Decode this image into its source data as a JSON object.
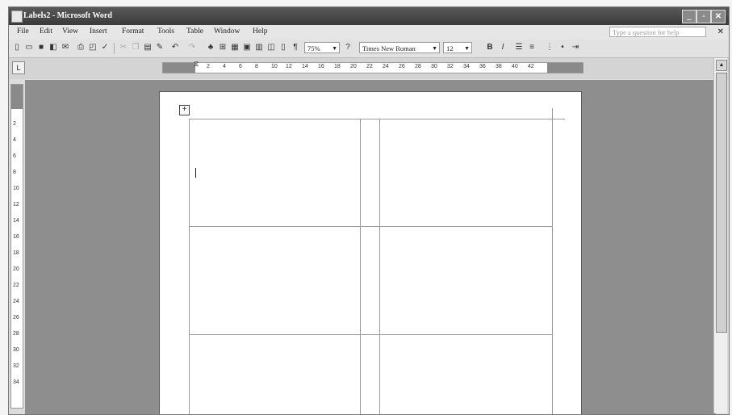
{
  "window": {
    "title": "Labels2 - Microsoft Word"
  },
  "menubar": {
    "items": [
      "File",
      "Edit",
      "View",
      "Insert",
      "Format",
      "Tools",
      "Table",
      "Window",
      "Help"
    ],
    "help_placeholder": "Type a question for help"
  },
  "toolbar": {
    "zoom": "75%",
    "font": "Times New Roman",
    "size": "12"
  },
  "ruler": {
    "ticks": [
      "2",
      "4",
      "6",
      "8",
      "10",
      "12",
      "14",
      "16",
      "18",
      "20",
      "22",
      "24",
      "26",
      "28",
      "30",
      "32",
      "34",
      "36",
      "38",
      "40",
      "42"
    ],
    "vticks": [
      "2",
      "4",
      "6",
      "8",
      "10",
      "12",
      "14",
      "16",
      "18",
      "20",
      "22",
      "24",
      "26",
      "28",
      "30",
      "32",
      "34"
    ]
  },
  "colors": {
    "titlebar": "#3a3a3a",
    "workspace": "#8e8e8e"
  },
  "icons": [
    "new-icon",
    "open-icon",
    "save-icon",
    "permission-icon",
    "email-icon",
    "print-icon",
    "print-preview-icon",
    "spelling-icon",
    "cut-icon",
    "copy-icon",
    "paste-icon",
    "format-painter-icon",
    "undo-icon",
    "redo-icon",
    "hyperlink-icon",
    "tables-borders-icon",
    "insert-table-icon",
    "insert-excel-icon",
    "columns-icon",
    "drawing-icon",
    "doc-map-icon",
    "show-hide-icon",
    "help-icon",
    "bold-icon",
    "italic-icon",
    "align-left-icon",
    "center-icon",
    "numbering-icon",
    "bullets-icon",
    "indent-icon"
  ]
}
